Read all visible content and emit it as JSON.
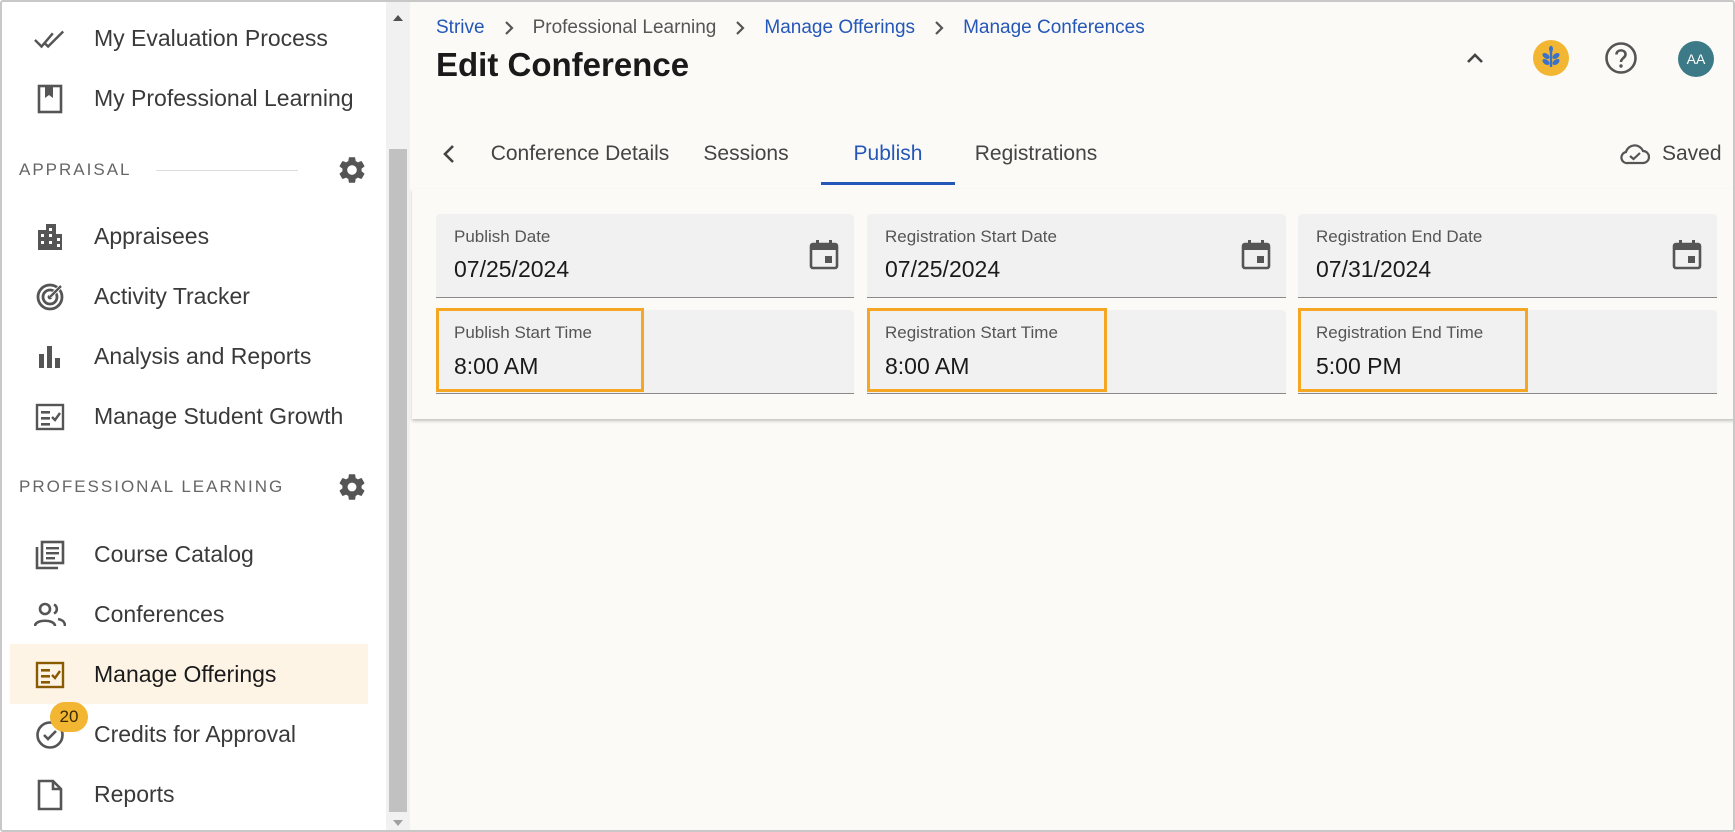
{
  "sidebar": {
    "items_top": [
      {
        "label": "My Evaluation Process",
        "icon": "double-check-icon"
      },
      {
        "label": "My Professional Learning",
        "icon": "bookmark-book-icon"
      }
    ],
    "section_appraisal": "APPRAISAL",
    "items_appraisal": [
      {
        "label": "Appraisees",
        "icon": "building-icon"
      },
      {
        "label": "Activity Tracker",
        "icon": "target-icon"
      },
      {
        "label": "Analysis and Reports",
        "icon": "bar-chart-icon"
      },
      {
        "label": "Manage Student Growth",
        "icon": "checklist-icon"
      }
    ],
    "section_pl": "PROFESSIONAL LEARNING",
    "items_pl": [
      {
        "label": "Course Catalog",
        "icon": "library-icon"
      },
      {
        "label": "Conferences",
        "icon": "people-icon"
      },
      {
        "label": "Manage Offerings",
        "icon": "checklist-icon",
        "active": true
      },
      {
        "label": "Credits for Approval",
        "icon": "check-circle-icon",
        "badge": "20"
      },
      {
        "label": "Reports",
        "icon": "document-icon"
      }
    ]
  },
  "breadcrumb": {
    "items": [
      "Strive",
      "Professional Learning",
      "Manage Offerings",
      "Manage Conferences"
    ]
  },
  "page_title": "Edit Conference",
  "header": {
    "avatar_initials": "AA"
  },
  "tabs": [
    "Conference Details",
    "Sessions",
    "Publish",
    "Registrations"
  ],
  "active_tab": "Publish",
  "saved_label": "Saved",
  "fields": {
    "publish_date": {
      "label": "Publish Date",
      "value": "07/25/2024"
    },
    "registration_start_date": {
      "label": "Registration Start Date",
      "value": "07/25/2024"
    },
    "registration_end_date": {
      "label": "Registration End Date",
      "value": "07/31/2024"
    },
    "publish_start_time": {
      "label": "Publish Start Time",
      "value": "8:00 AM"
    },
    "registration_start_time": {
      "label": "Registration Start Time",
      "value": "8:00 AM"
    },
    "registration_end_time": {
      "label": "Registration End Time",
      "value": "5:00 PM"
    }
  },
  "colors": {
    "link": "#2457b8",
    "active_item_bg": "#fdf4e6",
    "highlight": "#f5a623",
    "badge": "#f2b632",
    "avatar": "#3d7a87"
  }
}
